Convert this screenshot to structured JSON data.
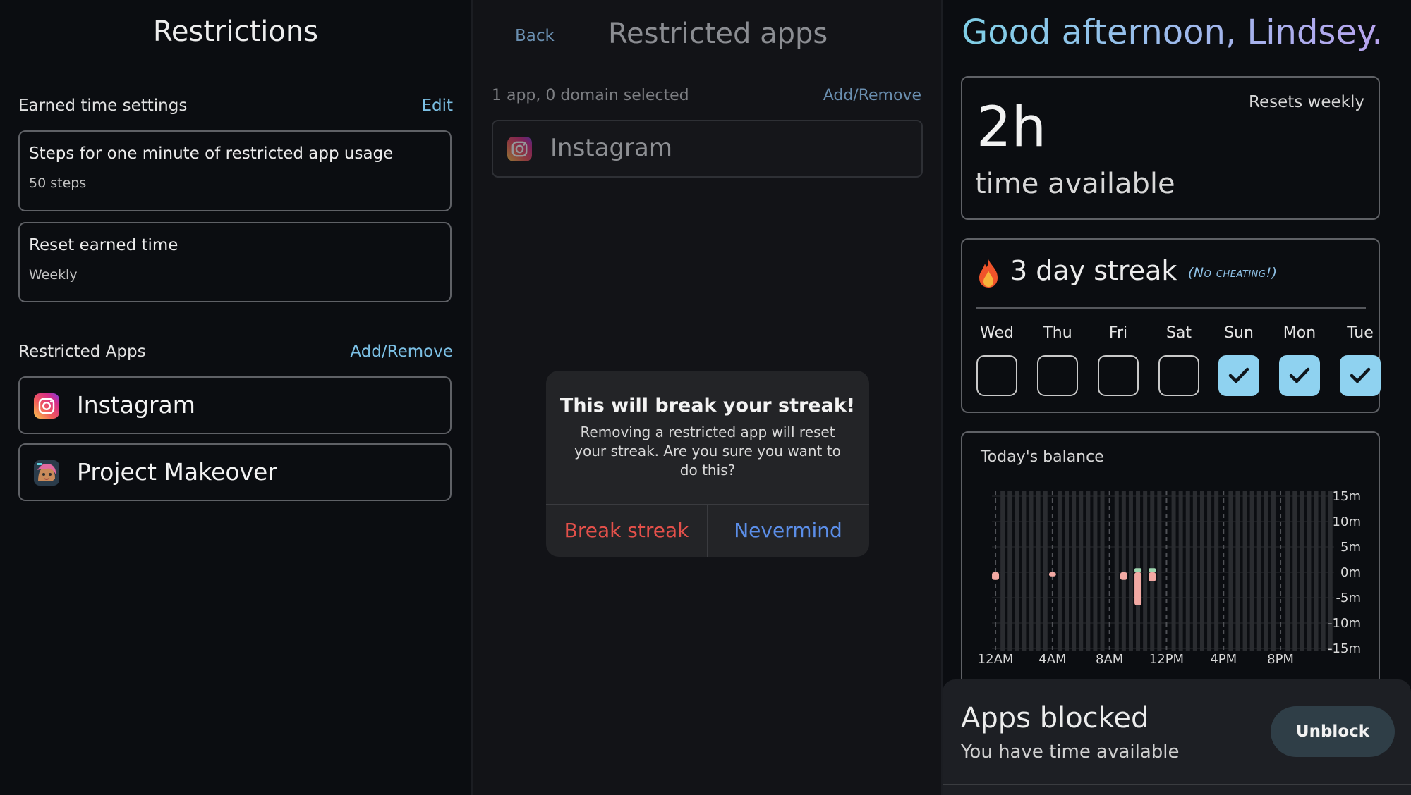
{
  "restrictions": {
    "title": "Restrictions",
    "earned_time_label": "Earned time settings",
    "edit_label": "Edit",
    "cards": [
      {
        "title": "Steps for one minute of restricted app usage",
        "value": "50 steps"
      },
      {
        "title": "Reset earned time",
        "value": "Weekly"
      }
    ],
    "restricted_apps_label": "Restricted Apps",
    "add_remove_label": "Add/Remove",
    "apps": [
      {
        "name": "Instagram",
        "icon": "instagram-icon"
      },
      {
        "name": "Project Makeover",
        "icon": "project-makeover-icon"
      }
    ]
  },
  "restricted_apps": {
    "back_label": "Back",
    "title": "Restricted apps",
    "selection_count": "1 app, 0 domain selected",
    "add_remove_label": "Add/Remove",
    "apps": [
      {
        "name": "Instagram",
        "icon": "instagram-icon"
      }
    ],
    "alert": {
      "title": "This will break your streak!",
      "message": "Removing a restricted app will reset your streak. Are you sure you want to do this?",
      "confirm_label": "Break streak",
      "cancel_label": "Nevermind"
    }
  },
  "home": {
    "greeting": "Good afternoon, Lindsey.",
    "time": {
      "value": "2h",
      "label": "time available",
      "resets": "Resets weekly"
    },
    "streak": {
      "text": "3 day streak",
      "note": "(No cheating!)",
      "days": [
        {
          "label": "Wed",
          "checked": false
        },
        {
          "label": "Thu",
          "checked": false
        },
        {
          "label": "Fri",
          "checked": false
        },
        {
          "label": "Sat",
          "checked": false
        },
        {
          "label": "Sun",
          "checked": true
        },
        {
          "label": "Mon",
          "checked": true
        },
        {
          "label": "Tue",
          "checked": true
        }
      ]
    },
    "balance": {
      "title": "Today's balance"
    },
    "blocked": {
      "title": "Apps blocked",
      "subtitle": "You have time available",
      "unblock_label": "Unblock"
    }
  },
  "chart_data": {
    "type": "bar",
    "title": "Today's balance",
    "x_tick_labels": [
      "12AM",
      "4AM",
      "8AM",
      "12PM",
      "4PM",
      "8PM"
    ],
    "y_tick_labels": [
      "15m",
      "10m",
      "5m",
      "0m",
      "-5m",
      "-10m",
      "-15m"
    ],
    "ylim": [
      -15,
      15
    ],
    "slots_per_hour": 2,
    "grid": true,
    "colors": {
      "negative": "#f2a9a3",
      "positive": "#9fd7b0",
      "grid": "#2a2c30",
      "grid_dashed": "#505257"
    },
    "series": [
      {
        "slot": 0,
        "value": -1.5
      },
      {
        "slot": 8,
        "value": -0.8
      },
      {
        "slot": 18,
        "value": -1.5
      },
      {
        "slot": 20,
        "value": -6.5,
        "positive_cap": 0.8
      },
      {
        "slot": 22,
        "value": -1.8,
        "positive_cap": 0.8
      }
    ]
  }
}
